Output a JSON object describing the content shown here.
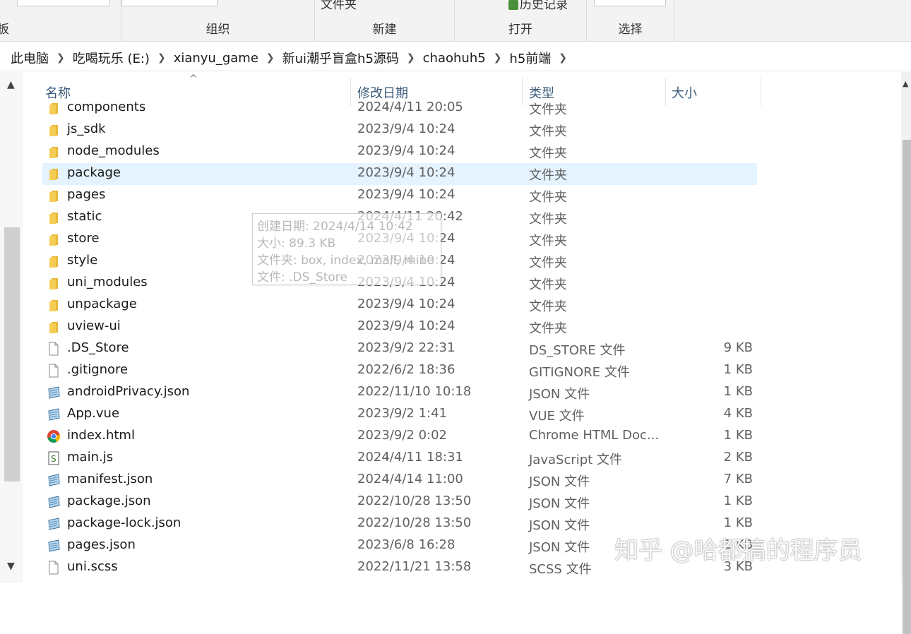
{
  "ribbon": {
    "groups": [
      {
        "label": "板"
      },
      {
        "label": "组织"
      },
      {
        "label": "新建",
        "top": "文件夹"
      },
      {
        "label": "打开",
        "top": "历史记录"
      },
      {
        "label": "选择"
      }
    ]
  },
  "breadcrumb": [
    "此电脑",
    "吃喝玩乐 (E:)",
    "xianyu_game",
    "新ui潮乎盲盒h5源码",
    "chaohuh5",
    "h5前端"
  ],
  "columns": {
    "name": "名称",
    "date": "修改日期",
    "type": "类型",
    "size": "大小"
  },
  "files": [
    {
      "name": "components",
      "date": "2024/4/11 20:05",
      "type": "文件夹",
      "size": "",
      "icon": "folder-icon"
    },
    {
      "name": "js_sdk",
      "date": "2023/9/4 10:24",
      "type": "文件夹",
      "size": "",
      "icon": "folder-icon"
    },
    {
      "name": "node_modules",
      "date": "2023/9/4 10:24",
      "type": "文件夹",
      "size": "",
      "icon": "folder-icon"
    },
    {
      "name": "package",
      "date": "2023/9/4 10:24",
      "type": "文件夹",
      "size": "",
      "icon": "folder-icon",
      "selected": true
    },
    {
      "name": "pages",
      "date": "2023/9/4 10:24",
      "type": "文件夹",
      "size": "",
      "icon": "folder-icon"
    },
    {
      "name": "static",
      "date": "2024/4/11 20:42",
      "type": "文件夹",
      "size": "",
      "icon": "folder-icon"
    },
    {
      "name": "store",
      "date": "2023/9/4 10:24",
      "type": "文件夹",
      "size": "",
      "icon": "folder-icon"
    },
    {
      "name": "style",
      "date": "2023/9/4 10:24",
      "type": "文件夹",
      "size": "",
      "icon": "folder-icon"
    },
    {
      "name": "uni_modules",
      "date": "2023/9/4 10:24",
      "type": "文件夹",
      "size": "",
      "icon": "folder-icon"
    },
    {
      "name": "unpackage",
      "date": "2023/9/4 10:24",
      "type": "文件夹",
      "size": "",
      "icon": "folder-icon"
    },
    {
      "name": "uview-ui",
      "date": "2023/9/4 10:24",
      "type": "文件夹",
      "size": "",
      "icon": "folder-icon"
    },
    {
      "name": ".DS_Store",
      "date": "2023/9/2 22:31",
      "type": "DS_STORE 文件",
      "size": "9 KB",
      "icon": "file-icon"
    },
    {
      "name": ".gitignore",
      "date": "2022/6/2 18:36",
      "type": "GITIGNORE 文件",
      "size": "1 KB",
      "icon": "file-icon"
    },
    {
      "name": "androidPrivacy.json",
      "date": "2022/11/10 10:18",
      "type": "JSON 文件",
      "size": "1 KB",
      "icon": "json-file-icon"
    },
    {
      "name": "App.vue",
      "date": "2023/9/2 1:41",
      "type": "VUE 文件",
      "size": "4 KB",
      "icon": "json-file-icon"
    },
    {
      "name": "index.html",
      "date": "2023/9/2 0:02",
      "type": "Chrome HTML Doc...",
      "size": "1 KB",
      "icon": "chrome-icon"
    },
    {
      "name": "main.js",
      "date": "2024/4/11 18:31",
      "type": "JavaScript 文件",
      "size": "2 KB",
      "icon": "script-file-icon"
    },
    {
      "name": "manifest.json",
      "date": "2024/4/14 11:00",
      "type": "JSON 文件",
      "size": "7 KB",
      "icon": "json-file-icon"
    },
    {
      "name": "package.json",
      "date": "2022/10/28 13:50",
      "type": "JSON 文件",
      "size": "1 KB",
      "icon": "json-file-icon"
    },
    {
      "name": "package-lock.json",
      "date": "2022/10/28 13:50",
      "type": "JSON 文件",
      "size": "1 KB",
      "icon": "json-file-icon"
    },
    {
      "name": "pages.json",
      "date": "2023/6/8 16:28",
      "type": "JSON 文件",
      "size": "1 KB",
      "icon": "json-file-icon"
    },
    {
      "name": "uni.scss",
      "date": "2022/11/21 13:58",
      "type": "SCSS 文件",
      "size": "3 KB",
      "icon": "file-icon"
    }
  ],
  "tooltip": {
    "line1": "创建日期: 2024/4/14 10:42",
    "line2": "大小: 89.3 KB",
    "line3": "文件夹: box, index, mall, mine",
    "line4": "文件: .DS_Store"
  },
  "watermark": "知乎 @哈都搞的程序员",
  "colors": {
    "selection": "#e5f3ff",
    "folder": "#f0c040",
    "header_text": "#3a5a7a"
  }
}
